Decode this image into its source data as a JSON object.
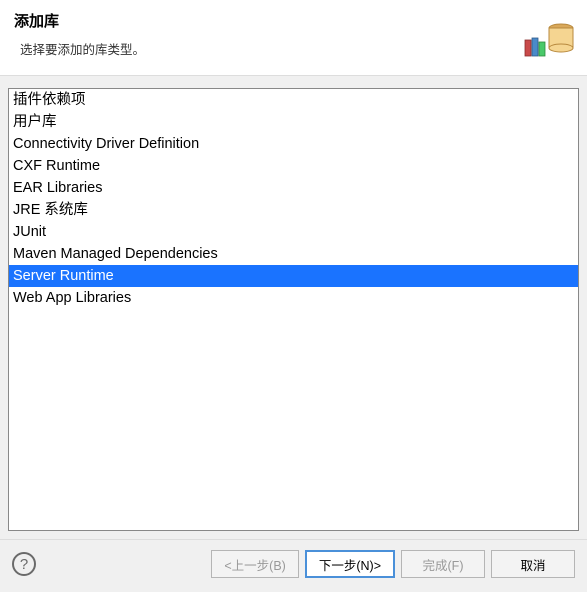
{
  "header": {
    "title": "添加库",
    "subtitle": "选择要添加的库类型。"
  },
  "list": {
    "items": [
      "插件依赖项",
      "用户库",
      "Connectivity Driver Definition",
      "CXF Runtime",
      "EAR Libraries",
      "JRE 系统库",
      "JUnit",
      "Maven Managed Dependencies",
      "Server Runtime",
      "Web App Libraries"
    ],
    "selected_index": 8
  },
  "footer": {
    "help_symbol": "?",
    "back": "<上一步(B)",
    "next": "下一步(N)>",
    "finish": "完成(F)",
    "cancel": "取消"
  },
  "icons": {
    "library": "library-icon"
  }
}
